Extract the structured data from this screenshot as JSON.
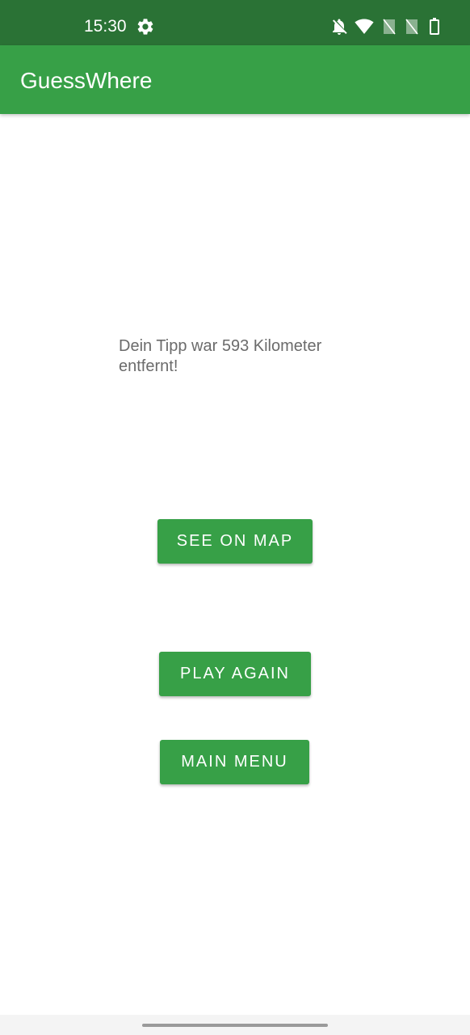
{
  "status_bar": {
    "time": "15:30",
    "icons": [
      "gear-icon",
      "notifications-off-icon",
      "wifi-icon",
      "signal-off-icon",
      "signal-off-icon",
      "battery-icon"
    ]
  },
  "app_bar": {
    "title": "GuessWhere"
  },
  "main": {
    "result_text": "Dein Tipp war 593 Kilometer entfernt!",
    "see_on_map_label": "SEE ON MAP",
    "play_again_label": "PLAY AGAIN",
    "main_menu_label": "MAIN MENU"
  },
  "colors": {
    "status_bar": "#2a7235",
    "accent": "#37a047",
    "text_secondary": "#6b6b6b"
  }
}
